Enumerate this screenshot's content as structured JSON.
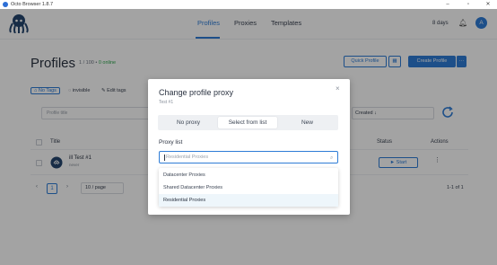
{
  "window": {
    "title": "Octo Browser 1.8.7",
    "min": "–",
    "max": "▫",
    "close": "✕"
  },
  "nav": {
    "tabs": [
      "Profiles",
      "Proxies",
      "Templates"
    ],
    "days": "8 days",
    "avatar": "A"
  },
  "page": {
    "title": "Profiles",
    "count": "1 / 100 •",
    "online": "0 online",
    "quick_profile": "Quick Profile",
    "create_profile": "Create Profile",
    "tags": {
      "no_tags": "No Tags",
      "invisible": "invisible",
      "edit_tags": "Edit tags"
    },
    "search_placeholder": "Profile title",
    "sort": "Created ↓",
    "columns": {
      "title": "Title",
      "status": "Status",
      "actions": "Actions"
    },
    "profile": {
      "name": "ill Test #1",
      "sub": "never",
      "start": "► Start"
    },
    "pager": {
      "prev": "‹",
      "current": "1",
      "next": "›",
      "page_size": "10 / page",
      "range": "1-1 of 1"
    }
  },
  "modal": {
    "title": "Change profile proxy",
    "subtitle": "Test #1",
    "close": "×",
    "options": [
      "No proxy",
      "Select from list",
      "New"
    ],
    "selected_option": "Select from list",
    "proxy_list_label": "Proxy list",
    "proxy_input_placeholder": "Residential Proxies",
    "dropdown": [
      "Datacenter Proxies",
      "Shared Datacenter Proxies",
      "Residential Proxies"
    ],
    "dropdown_active": "Residential Proxies"
  },
  "colors": {
    "accent": "#2e7cd6",
    "online": "#2fa84f"
  },
  "icons": [
    "octopus-logo-icon",
    "bell-icon",
    "refresh-icon",
    "search-icon",
    "tag-icon",
    "eye-icon",
    "edit-icon",
    "fingerprint-icon",
    "grid-icon",
    "chevron-down-icon",
    "close-icon"
  ]
}
